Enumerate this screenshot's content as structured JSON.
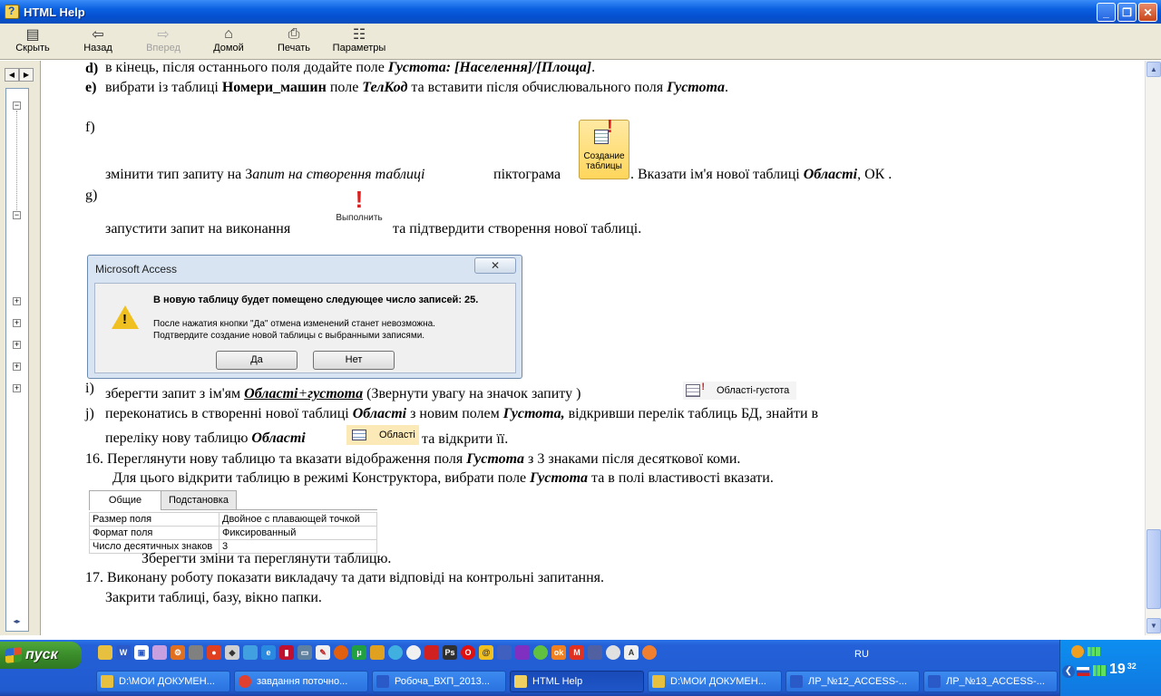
{
  "window": {
    "title": "HTML Help"
  },
  "toolbar": {
    "hide": "Скрыть",
    "back": "Назад",
    "forward": "Вперед",
    "home": "Домой",
    "print": "Печать",
    "options": "Параметры"
  },
  "doc": {
    "d": {
      "label": "d)",
      "t1": "в кінець, після останнього поля додайте поле",
      "t2": "Густота: [Населення]/[Площа]",
      "t3": "."
    },
    "e": {
      "label": "e)",
      "t1": "вибрати із таблиці",
      "t2": "Номери_машин",
      "t3": "поле",
      "t4": "ТелКод",
      "t5": "та вставити після обчислювального поля",
      "t6": "Густота",
      "t7": "."
    },
    "f": {
      "label": "f)",
      "t1": "змінити тип запиту на З",
      "t2": "апит на створення таблиці",
      "t3": "піктограма",
      "t4": ". Вказати  ім'я нової таблиці",
      "t5": "Області",
      "t6": ", ОК .",
      "btn_line1": "Создание",
      "btn_line2": "таблицы"
    },
    "g": {
      "label": "g)",
      "t1": "запустити запит на виконання",
      "t2": "та підтвердити створення нової таблиці.",
      "run_label": "Выполнить"
    },
    "dialog": {
      "title": "Microsoft Access",
      "message": "В новую таблицу будет помещено следующее число записей: 25.",
      "line2": "После нажатия кнопки \"Да\" отмена изменений станет невозможна.",
      "line3": "Подтвердите создание новой таблицы с выбранными записями.",
      "yes": "Да",
      "no": "Нет"
    },
    "i": {
      "label": "i)",
      "t1": "зберегти запит  з ім'ям",
      "t2": "Області",
      "t3": "+",
      "t4": "густота",
      "t5": "(Звернути увагу на значок запиту )",
      "query_name": "Області-густота"
    },
    "j": {
      "label": "j)",
      "t1": "переконатись в створенні нової таблиці",
      "t2": "Області",
      "t3": "з новим полем",
      "t4": "Густота,",
      "t5": "відкривши перелік таблиць БД, знайти в",
      "t6": "переліку нову таблицю",
      "t7": "Області",
      "t8": "та відкрити її.",
      "table_name": "Області"
    },
    "s16": {
      "t1": "16. Переглянути нову таблицю  та вказати відображення поля",
      "t2": "Густота",
      "t3": "з 3 знаками після десяткової коми.",
      "t4": "Для цього відкрити таблицю в режимі Конструктора, вибрати поле",
      "t5": "Густота",
      "t6": "та в полі властивості вказати."
    },
    "props": {
      "tab1": "Общие",
      "tab2": "Подстановка",
      "rows": [
        {
          "k": "Размер поля",
          "v": "Двойное с плавающей точкой"
        },
        {
          "k": "Формат поля",
          "v": "Фиксированный"
        },
        {
          "k": "Число десятичных знаков",
          "v": "3"
        }
      ]
    },
    "save": "Зберегти зміни та переглянути таблицю.",
    "s17": {
      "t1": "17.  Виконану роботу показати викладачу та дати відповіді на контрольні запитання.",
      "t2": "Закрити таблиці, базу, вікно папки."
    }
  },
  "taskbar": {
    "start": "пуск",
    "lang": "RU",
    "clock": "19",
    "clock_min": "32",
    "tasks": [
      {
        "label": "D:\\МОИ ДОКУМЕН...",
        "color": "#e8c040"
      },
      {
        "label": "завдання поточно...",
        "color": "#e04030"
      },
      {
        "label": "Робоча_ВХП_2013...",
        "color": "#2a5ac8"
      },
      {
        "label": "HTML Help",
        "color": "#f0d060"
      },
      {
        "label": "D:\\МОИ ДОКУМЕН...",
        "color": "#e8c040"
      },
      {
        "label": "ЛР_№12_ACCESS-...",
        "color": "#2a5ac8"
      },
      {
        "label": "ЛР_№13_ACCESS-...",
        "color": "#2a5ac8"
      }
    ]
  }
}
